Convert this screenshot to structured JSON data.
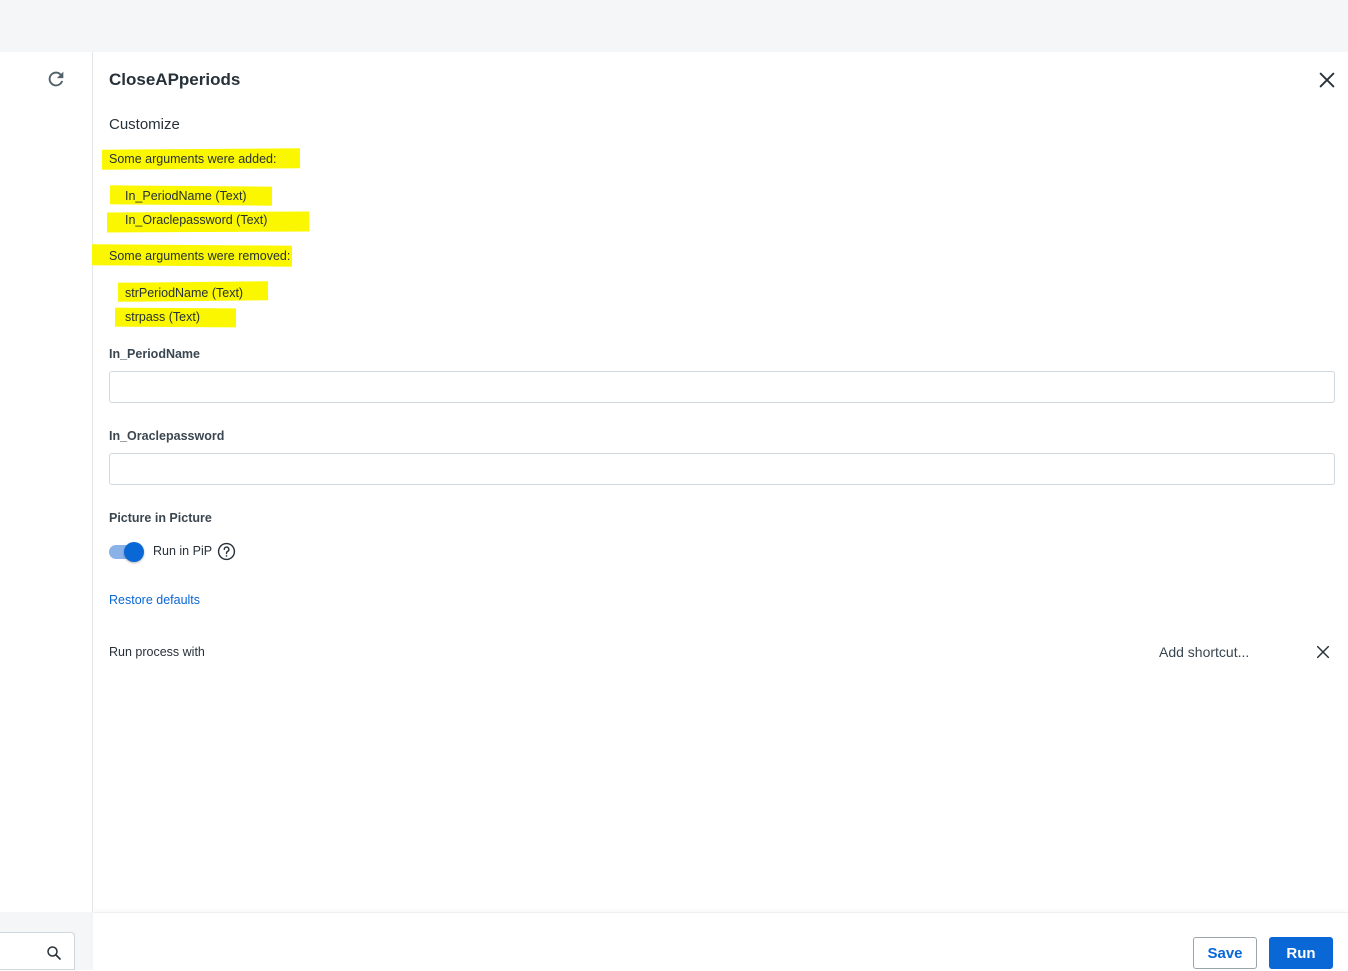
{
  "panel": {
    "title": "CloseAPperiods",
    "section": "Customize"
  },
  "notices": {
    "added_heading": "Some arguments were added:",
    "added_items": [
      "In_PeriodName (Text)",
      "In_Oraclepassword (Text)"
    ],
    "removed_heading": "Some arguments were removed:",
    "removed_items": [
      "strPeriodName (Text)",
      "strpass (Text)"
    ]
  },
  "fields": [
    {
      "label": "In_PeriodName",
      "value": ""
    },
    {
      "label": "In_Oraclepassword",
      "value": ""
    }
  ],
  "pip": {
    "heading": "Picture in Picture",
    "toggle_label": "Run in PiP",
    "enabled": true
  },
  "restore_defaults": "Restore defaults",
  "shortcut": {
    "label": "Run process with",
    "placeholder": "Add shortcut..."
  },
  "buttons": {
    "save": "Save",
    "run": "Run"
  },
  "colors": {
    "accent": "#0a67d6",
    "highlight": "#fbf700"
  },
  "icons": {
    "refresh": "refresh-icon",
    "close": "close-icon",
    "help": "help-icon",
    "search": "search-icon"
  }
}
